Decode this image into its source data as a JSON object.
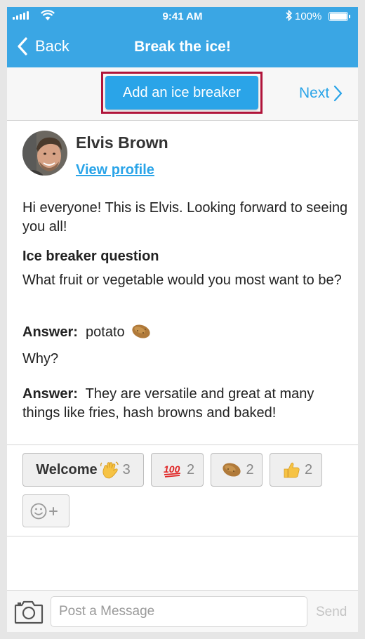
{
  "status_bar": {
    "time": "9:41 AM",
    "battery": "100%"
  },
  "nav": {
    "back_label": "Back",
    "title": "Break the ice!"
  },
  "toolbar": {
    "add_button_label": "Add an ice breaker",
    "next_label": "Next"
  },
  "profile": {
    "name": "Elvis Brown",
    "link_label": "View profile"
  },
  "post": {
    "intro": "Hi everyone! This is Elvis. Looking forward to seeing you all!",
    "question_heading": "Ice breaker question",
    "question": "What fruit or vegetable would you most want to be?",
    "answer_label": "Answer:",
    "answer_1": "potato",
    "why_label": "Why?",
    "answer_2": "They are versatile and great at many things like fries, hash browns and baked!"
  },
  "reactions": [
    {
      "label": "Welcome",
      "icon": "waving-hand-icon",
      "count": "3"
    },
    {
      "label": "",
      "icon": "hundred-points-icon",
      "count": "2"
    },
    {
      "label": "",
      "icon": "potato-icon",
      "count": "2"
    },
    {
      "label": "",
      "icon": "thumbs-up-icon",
      "count": "2"
    }
  ],
  "composer": {
    "placeholder": "Post a Message",
    "send_label": "Send"
  },
  "colors": {
    "accent": "#3aa6e4",
    "button": "#2aa4e8",
    "highlight_border": "#b0143a"
  }
}
